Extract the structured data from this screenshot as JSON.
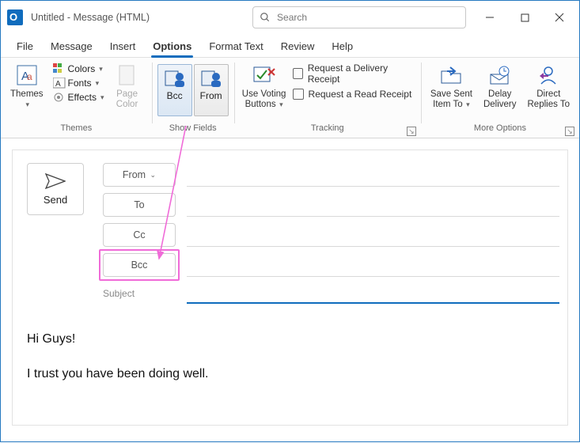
{
  "titlebar": {
    "title": "Untitled  -  Message (HTML)"
  },
  "search": {
    "placeholder": "Search"
  },
  "menus": {
    "file": "File",
    "message": "Message",
    "insert": "Insert",
    "options": "Options",
    "format": "Format Text",
    "review": "Review",
    "help": "Help"
  },
  "ribbon": {
    "themes": {
      "label": "Themes",
      "themes_btn": "Themes",
      "colors": "Colors",
      "fonts": "Fonts",
      "effects": "Effects",
      "page_color": "Page\nColor"
    },
    "show_fields": {
      "label": "Show Fields",
      "bcc": "Bcc",
      "from": "From"
    },
    "tracking": {
      "label": "Tracking",
      "voting": "Use Voting\nButtons",
      "delivery": "Request a Delivery Receipt",
      "read": "Request a Read Receipt"
    },
    "more": {
      "label": "More Options",
      "save_sent": "Save Sent\nItem To",
      "delay": "Delay\nDelivery",
      "direct": "Direct\nReplies To"
    }
  },
  "compose": {
    "send": "Send",
    "from": "From",
    "to": "To",
    "cc": "Cc",
    "bcc": "Bcc",
    "subject_label": "Subject"
  },
  "email_body": {
    "line1": "Hi Guys!",
    "line2": "I trust you have been doing well."
  }
}
